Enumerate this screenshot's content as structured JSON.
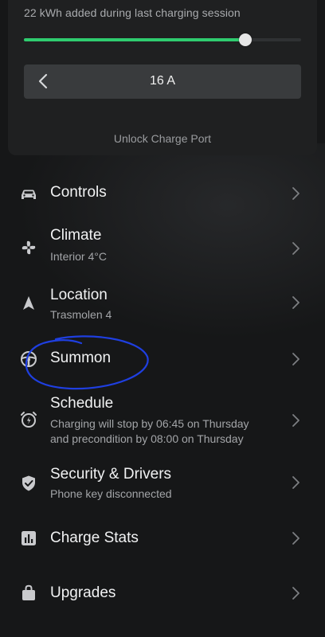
{
  "charging": {
    "session_text": "22 kWh added during last charging session",
    "slider_fraction": 0.8,
    "current_value": "16 A",
    "unlock_label": "Unlock Charge Port",
    "accent_color": "#2fcc6f"
  },
  "menu": {
    "items": [
      {
        "title": "Controls",
        "subtitle": "",
        "icon": "car-icon"
      },
      {
        "title": "Climate",
        "subtitle": "Interior 4°C",
        "icon": "fan-icon"
      },
      {
        "title": "Location",
        "subtitle": "Trasmolen 4",
        "icon": "navigation-arrow-icon"
      },
      {
        "title": "Summon",
        "subtitle": "",
        "icon": "steering-wheel-icon"
      },
      {
        "title": "Schedule",
        "subtitle_lines": [
          "Charging will stop by 06:45 on Thursday",
          "and precondition by 08:00 on Thursday"
        ],
        "icon": "alarm-clock-icon"
      },
      {
        "title": "Security & Drivers",
        "subtitle": "Phone key disconnected",
        "icon": "shield-icon"
      },
      {
        "title": "Charge Stats",
        "subtitle": "",
        "icon": "bar-chart-icon"
      },
      {
        "title": "Upgrades",
        "subtitle": "",
        "icon": "shopping-bag-icon"
      }
    ]
  },
  "annotation": {
    "color": "#1f3fe0",
    "target": "Summon"
  }
}
